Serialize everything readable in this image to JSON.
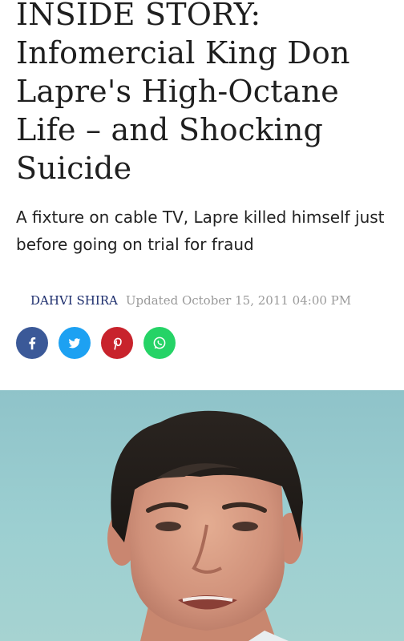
{
  "article": {
    "headline": "INSIDE STORY: Infomercial King Don Lapre's High-Octane Life – and Shocking Suicide",
    "subhead": "A fixture on cable TV, Lapre killed himself just before going on trial for fraud",
    "author": "DAHVI SHIRA",
    "updated": "Updated October 15, 2011 04:00 PM"
  },
  "share": [
    {
      "name": "facebook-icon",
      "color": "#3b5998"
    },
    {
      "name": "twitter-icon",
      "color": "#1da1f2"
    },
    {
      "name": "pinterest-icon",
      "color": "#c8232c"
    },
    {
      "name": "whatsapp-icon",
      "color": "#25d366"
    }
  ],
  "hero": {
    "icon": "person-photo",
    "sky_color": "#9ccfd1"
  }
}
